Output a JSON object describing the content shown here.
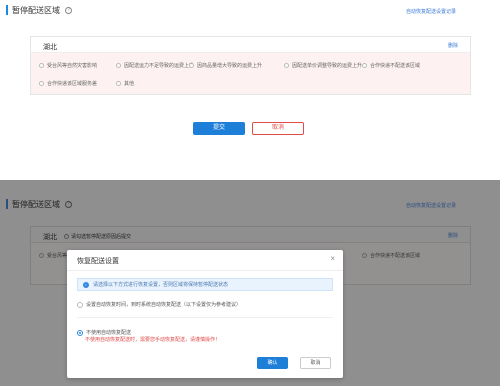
{
  "section": {
    "title": "暂停配送区域",
    "help_icon": "question-circle-icon",
    "top_link": "自动恢复配送设置记录"
  },
  "region": {
    "name": "湖北",
    "delete_label": "删除",
    "reasons": [
      "受台风等自然灾害影响",
      "因配送运力不足导致的运费上升",
      "因商品量增大导致的运费上升",
      "因配送单价调整导致的运费上升",
      "合作快递不配送该区域",
      "合作快递该区域服务差",
      "其他"
    ]
  },
  "actions": {
    "submit": "提交",
    "cancel": "取消"
  },
  "overlay": {
    "inline_note": "请勾选暂停配送原因后提交"
  },
  "modal": {
    "title": "恢复配送设置",
    "close": "×",
    "info_text": "请选择以下方式进行恢复设置，否则区域将保持暂停配送状态",
    "option_auto": "设置自动恢复时间，到时系统自动恢复配送（以下设置仅为参考建议）",
    "option_manual": "不使用自动恢复配送",
    "warning": "不使用自动恢复配送时，需要您手动恢复配送，请谨慎操作！",
    "confirm": "确认",
    "cancel": "取消"
  },
  "colors": {
    "primary": "#1e7fd8",
    "danger": "#e04b4b",
    "overlay": "#8f8f8f"
  }
}
